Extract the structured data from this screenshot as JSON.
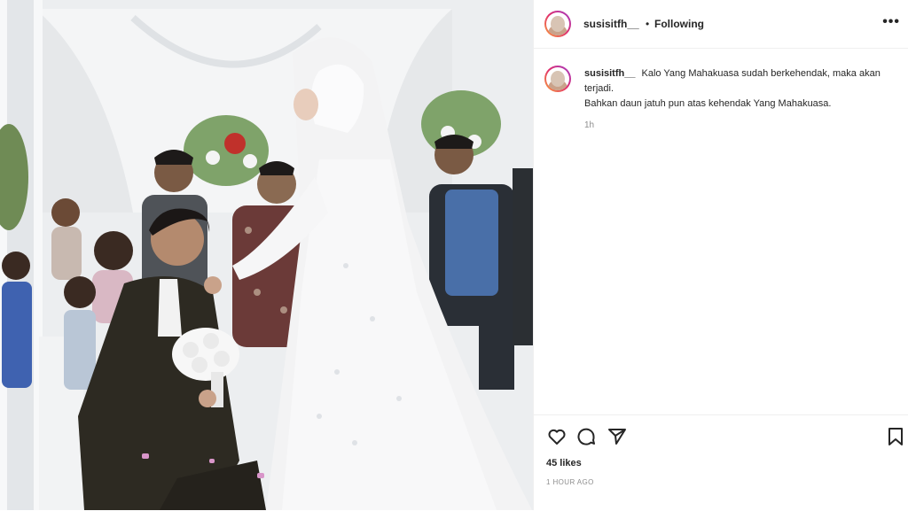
{
  "post": {
    "username": "susisitfh__",
    "follow_separator": "•",
    "follow_status": "Following",
    "more_icon": "more-horizontal-icon",
    "caption_username": "susisitfh__",
    "caption_line1": "Kalo Yang Mahakuasa sudah berkehendak, maka akan terjadi.",
    "caption_line2": "Bahkan daun jatuh pun atas kehendak Yang Mahakuasa.",
    "caption_time": "1h",
    "likes": "45 likes",
    "posted_ago": "1 HOUR AGO"
  },
  "icons": [
    "heart-icon",
    "comment-icon",
    "share-icon",
    "bookmark-icon"
  ],
  "photo": {
    "description_tags": [
      "wedding",
      "kneeling groom",
      "bride in white gown"
    ]
  }
}
